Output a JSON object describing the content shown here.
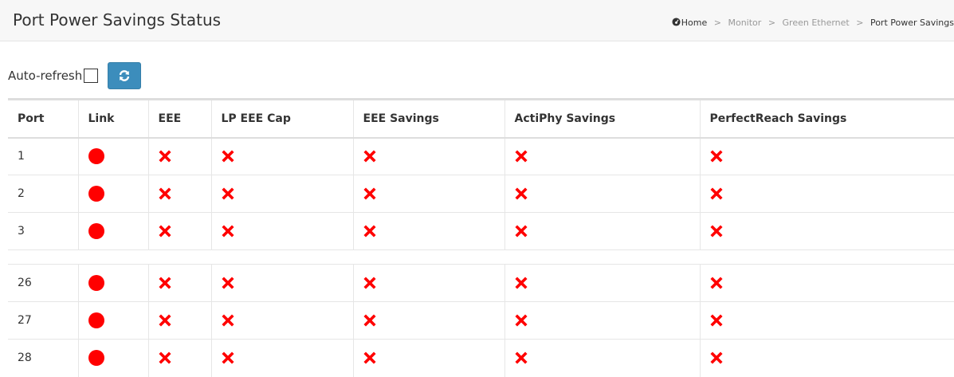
{
  "header": {
    "title": "Port Power Savings Status"
  },
  "breadcrumb": {
    "home": "Home",
    "items": [
      "Monitor",
      "Green Ethernet"
    ],
    "current": "Port Power Savings"
  },
  "toolbar": {
    "auto_refresh_label": "Auto-refresh",
    "auto_refresh_checked": false,
    "refresh_icon": "refresh-icon"
  },
  "table": {
    "columns": [
      "Port",
      "Link",
      "EEE",
      "LP EEE Cap",
      "EEE Savings",
      "ActiPhy Savings",
      "PerfectReach Savings"
    ],
    "rows_top": [
      {
        "port": "1",
        "link": "down",
        "eee": "disabled",
        "lp_eee_cap": "no",
        "eee_savings": "no",
        "actiphy_savings": "no",
        "perfectreach_savings": "no"
      },
      {
        "port": "2",
        "link": "down",
        "eee": "disabled",
        "lp_eee_cap": "no",
        "eee_savings": "no",
        "actiphy_savings": "no",
        "perfectreach_savings": "no"
      },
      {
        "port": "3",
        "link": "down",
        "eee": "disabled",
        "lp_eee_cap": "no",
        "eee_savings": "no",
        "actiphy_savings": "no",
        "perfectreach_savings": "no"
      }
    ],
    "rows_bottom": [
      {
        "port": "26",
        "link": "down",
        "eee": "disabled",
        "lp_eee_cap": "no",
        "eee_savings": "no",
        "actiphy_savings": "no",
        "perfectreach_savings": "no"
      },
      {
        "port": "27",
        "link": "down",
        "eee": "disabled",
        "lp_eee_cap": "no",
        "eee_savings": "no",
        "actiphy_savings": "no",
        "perfectreach_savings": "no"
      },
      {
        "port": "28",
        "link": "down",
        "eee": "disabled",
        "lp_eee_cap": "no",
        "eee_savings": "no",
        "actiphy_savings": "no",
        "perfectreach_savings": "no"
      }
    ]
  },
  "colors": {
    "link_down": "#ff0000",
    "cross": "#ff0000",
    "accent": "#3c8dbc"
  }
}
